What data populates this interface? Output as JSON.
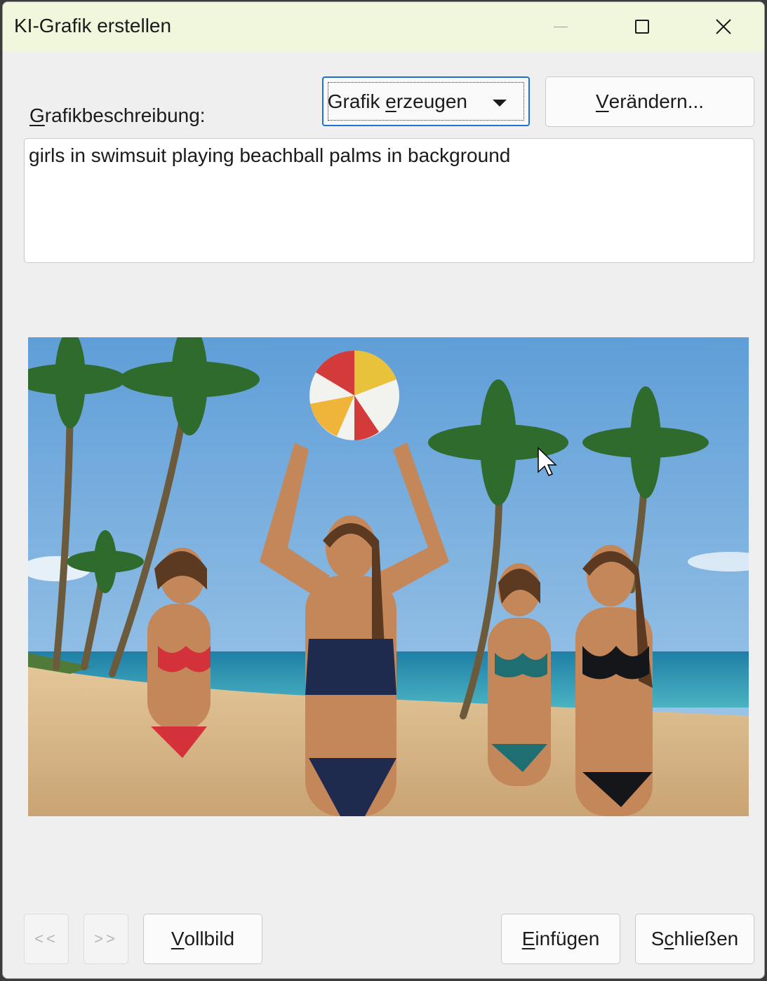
{
  "window": {
    "title": "KI-Grafik erstellen"
  },
  "form": {
    "description_label_first": "G",
    "description_label_rest": "rafikbeschreibung:",
    "mode_select": {
      "value_pre": "Grafik ",
      "value_underlined": "e",
      "value_post": "rzeugen"
    },
    "change_button": {
      "underlined": "V",
      "rest": "erändern..."
    },
    "description_text": "girls in swimsuit playing beachball palms in background"
  },
  "preview": {
    "alt": "Generated image: girls in swimsuits playing with a beachball, palms in background"
  },
  "footer": {
    "prev_label": "<<",
    "next_label": ">>",
    "fullscreen": {
      "underlined": "V",
      "rest": "ollbild"
    },
    "insert": {
      "underlined": "E",
      "rest": "infügen"
    },
    "close": {
      "pre": "S",
      "underlined": "c",
      "rest": "hließen"
    }
  },
  "colors": {
    "titlebar_bg": "#f0f7dc",
    "dialog_bg": "#efefef",
    "focus_border": "#1e6fd0",
    "sky": "#6fa6d8",
    "sand": "#d9b98c",
    "sea": "#2f8fb0"
  },
  "icons": {
    "minimize": "minimize-icon",
    "maximize": "maximize-icon",
    "close": "close-icon",
    "dropdown": "chevron-down-icon",
    "cursor": "mouse-pointer-icon"
  }
}
